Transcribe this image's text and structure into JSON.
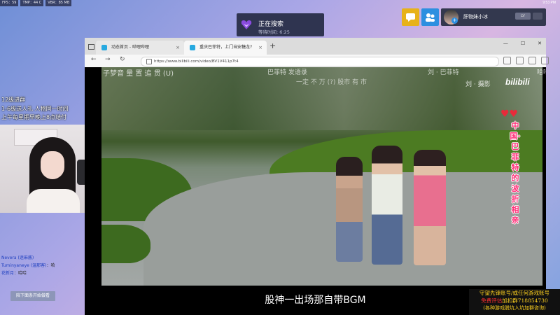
{
  "stats": [
    "FPS：59",
    "TMP：44 C",
    "VBR：85 MB"
  ],
  "clock": "9:53 PM",
  "search_banner": {
    "title": "正在搜索",
    "wait_label": "等待时间: 6:25"
  },
  "user": {
    "name": "肝物妹小冰",
    "badge": "LV"
  },
  "overlay_notes": [
    "12级进群",
    "1-6级送人礼 人物同一时间",
    "上午每星期早晚上8点结付"
  ],
  "chat": [
    {
      "user": "Nevera (迷麻酱)",
      "msg": ""
    },
    {
      "user": "Tuminyaneye (温那客)",
      "msg": "：哈"
    },
    {
      "user": "花新月",
      "msg": "：哈哈"
    }
  ],
  "follow_button": "陪下面条开始做看",
  "browser": {
    "tabs": [
      {
        "label": "动态首页 - 哔哩哔哩",
        "active": false
      },
      {
        "label": "重庆巴菲特，上门当安糖龙?",
        "active": true
      }
    ],
    "new_tab": "+",
    "url": "https://www.bilibili.com/video/BV1V411p7t4"
  },
  "video": {
    "watermark_tl": "子梦音 量 置 追 贯 (U)",
    "watermark_top1": "巴菲特 发语录",
    "watermark_top2": "一定 不 万 (?) 股市 有 市",
    "watermark_tr1": "刘 · 巴菲特",
    "watermark_tr2": "哈哈哈",
    "watermark_tr3": "刘 · 摄影",
    "bili_logo": "bilibili",
    "hearts": "♥♥",
    "side_caption": "中国·巴菲特的波折相亲",
    "subtitle": "股神一出场那自带BGM"
  },
  "ad": {
    "line1": "守望先锋账号/或任何游戏账号",
    "line2_prefix": "免费评估",
    "line2_suffix": "加扣群718854730",
    "line3": "(各种游戏脱坑入坑加群咨询)"
  },
  "colors": {
    "search_bg": "#2f3450",
    "bili_pink": "#ff2f78",
    "ad_yellow": "#ffd21f",
    "ad_red": "#ff3030"
  }
}
